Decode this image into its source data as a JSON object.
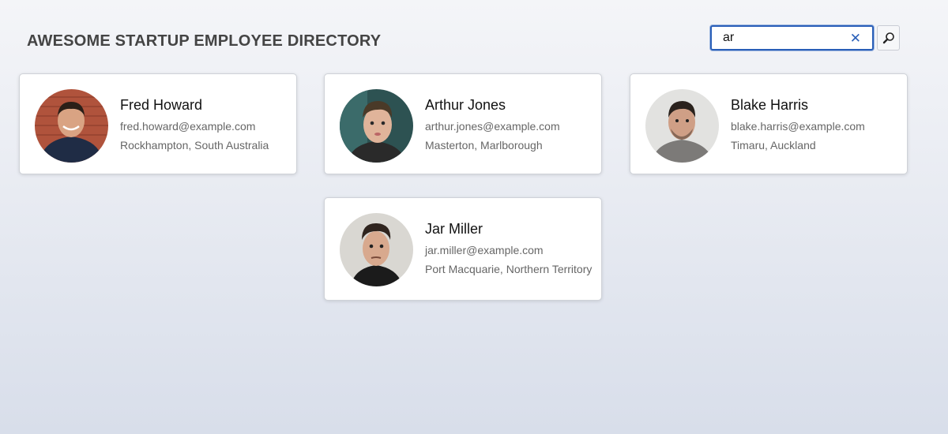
{
  "header": {
    "title": "AWESOME STARTUP EMPLOYEE DIRECTORY"
  },
  "search": {
    "value": "ar",
    "clear_icon": "close-icon",
    "button_icon": "search-icon"
  },
  "employees": [
    {
      "name": "Fred Howard",
      "email": "fred.howard@example.com",
      "location": "Rockhampton, South Australia"
    },
    {
      "name": "Arthur Jones",
      "email": "arthur.jones@example.com",
      "location": "Masterton, Marlborough"
    },
    {
      "name": "Blake Harris",
      "email": "blake.harris@example.com",
      "location": "Timaru, Auckland"
    },
    {
      "name": "Jar Miller",
      "email": "jar.miller@example.com",
      "location": "Port Macquarie, Northern Territory"
    }
  ],
  "colors": {
    "accent": "#2a5fb8",
    "text_secondary": "#666666"
  }
}
